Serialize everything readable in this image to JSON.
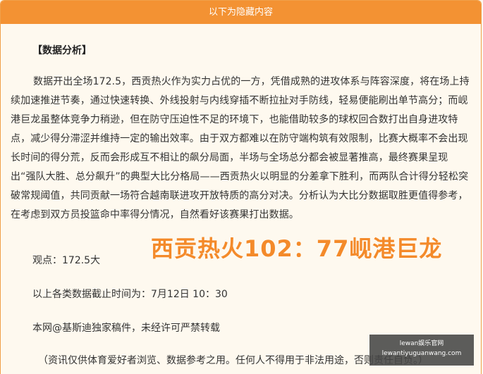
{
  "banner": {
    "text": "以下为隐藏内容"
  },
  "heading": "【数据分析】",
  "paragraph": "数据开出全场172.5，西贡热火作为实力占优的一方，凭借成熟的进攻体系与阵容深度，将在场上持续加速推进节奏，通过快速转换、外线投射与内线穿插不断拉扯对手防线，轻易便能刷出单节高分；而岘港巨龙虽整体竞争力稍逊，但在防守压迫性不足的环境下，也能借助较多的球权回合数打出自身进攻特点，减少得分滞涩并维持一定的输出效率。由于双方都难以在防守端构筑有效限制，比赛大概率不会出现长时间的得分荒，反而会形成互不相让的飙分局面，半场与全场总分都会被显著推高，最终赛果呈现出“强队大胜、总分飙升”的典型大比分格局——西贡热火以明显的分差拿下胜利，而两队合计得分轻松突破常规阈值，共同贡献一场符合越南联进攻开放特质的高分对决。分析认为大比分数据取胜更值得参考，在考虑到双方员投篮命中率得分情况，自然看好该赛果打出数据。",
  "viewpoint": "观点：172.5大",
  "cutoff": "以上各类数据截止时间为：7月12日 10：30",
  "copyright": "本网@基斯迪独家稿件，未经许可严禁转载",
  "disclaimer": "（资讯仅供体育爱好者浏览、数据参考之用。任何人不得用于非法用途，否则责任自负。）",
  "overlay_score": "西贡热火102：77岘港巨龙",
  "watermark": {
    "line1": "lewan娱乐官网",
    "line2": "lewantiyuguanwang.com"
  }
}
